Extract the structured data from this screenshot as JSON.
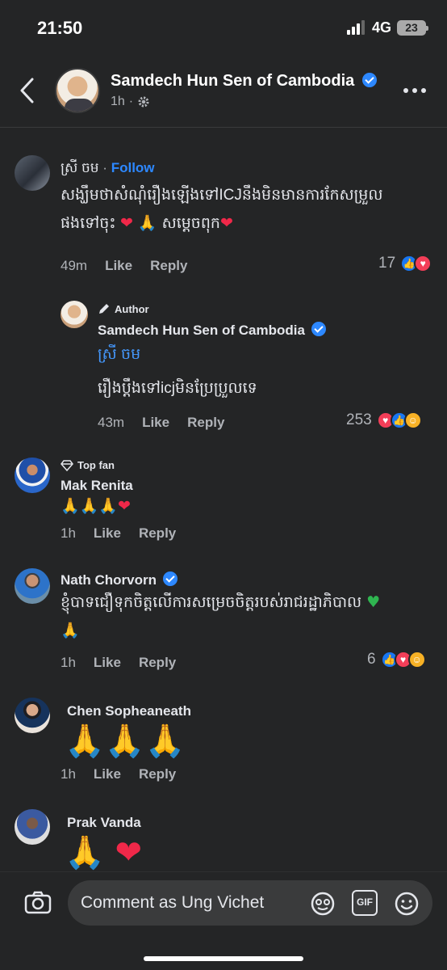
{
  "status_bar": {
    "time": "21:50",
    "network": "4G",
    "battery": "23"
  },
  "header": {
    "page_name": "Samdech Hun Sen of Cambodia",
    "time": "1h",
    "separator": "·"
  },
  "comments": [
    {
      "author": "ស្រី ចម",
      "separator": "·",
      "follow_label": "Follow",
      "line1": "សង្ឃឹមថាសំណុំរឿងឡើងទៅICJនឹងមិនមានការកែសម្រួល",
      "line2a": "ផងទៅចុះ ",
      "line2b": "សម្ដេចពុក",
      "time": "49m",
      "like_label": "Like",
      "reply_label": "Reply",
      "reaction_count": "17"
    },
    {
      "badge": "Author",
      "author": "Samdech Hun Sen of Cambodia",
      "mention": "ស្រី ចម",
      "text": "រឿងប្ដឹងទៅicjមិនប្រែប្រួលទេ",
      "time": "43m",
      "like_label": "Like",
      "reply_label": "Reply",
      "reaction_count": "253"
    },
    {
      "badge": "Top fan",
      "author": "Mak Renita",
      "time": "1h",
      "like_label": "Like",
      "reply_label": "Reply"
    },
    {
      "author": "Nath Chorvorn",
      "line1": "ខ្ញុំបាទជឿទុកចិត្តលើការសម្រេចចិត្តរបស់រាជរដ្ឋាភិបាល",
      "time": "1h",
      "like_label": "Like",
      "reply_label": "Reply",
      "reaction_count": "6"
    },
    {
      "author": "Chen Sopheaneath",
      "time": "1h",
      "like_label": "Like",
      "reply_label": "Reply"
    },
    {
      "author": "Prak Vanda"
    }
  ],
  "composer": {
    "placeholder": "Comment as Ung Vichet",
    "gif_label": "GIF"
  },
  "colors": {
    "background": "#242526",
    "accent": "#2d88ff",
    "muted": "#b0b3b8"
  },
  "icons": [
    "back-chevron-icon",
    "gear-icon",
    "more-dots-icon",
    "verified-badge-icon",
    "pencil-icon",
    "diamond-icon",
    "camera-icon",
    "sticker-icon",
    "gif-icon",
    "emoji-icon"
  ]
}
